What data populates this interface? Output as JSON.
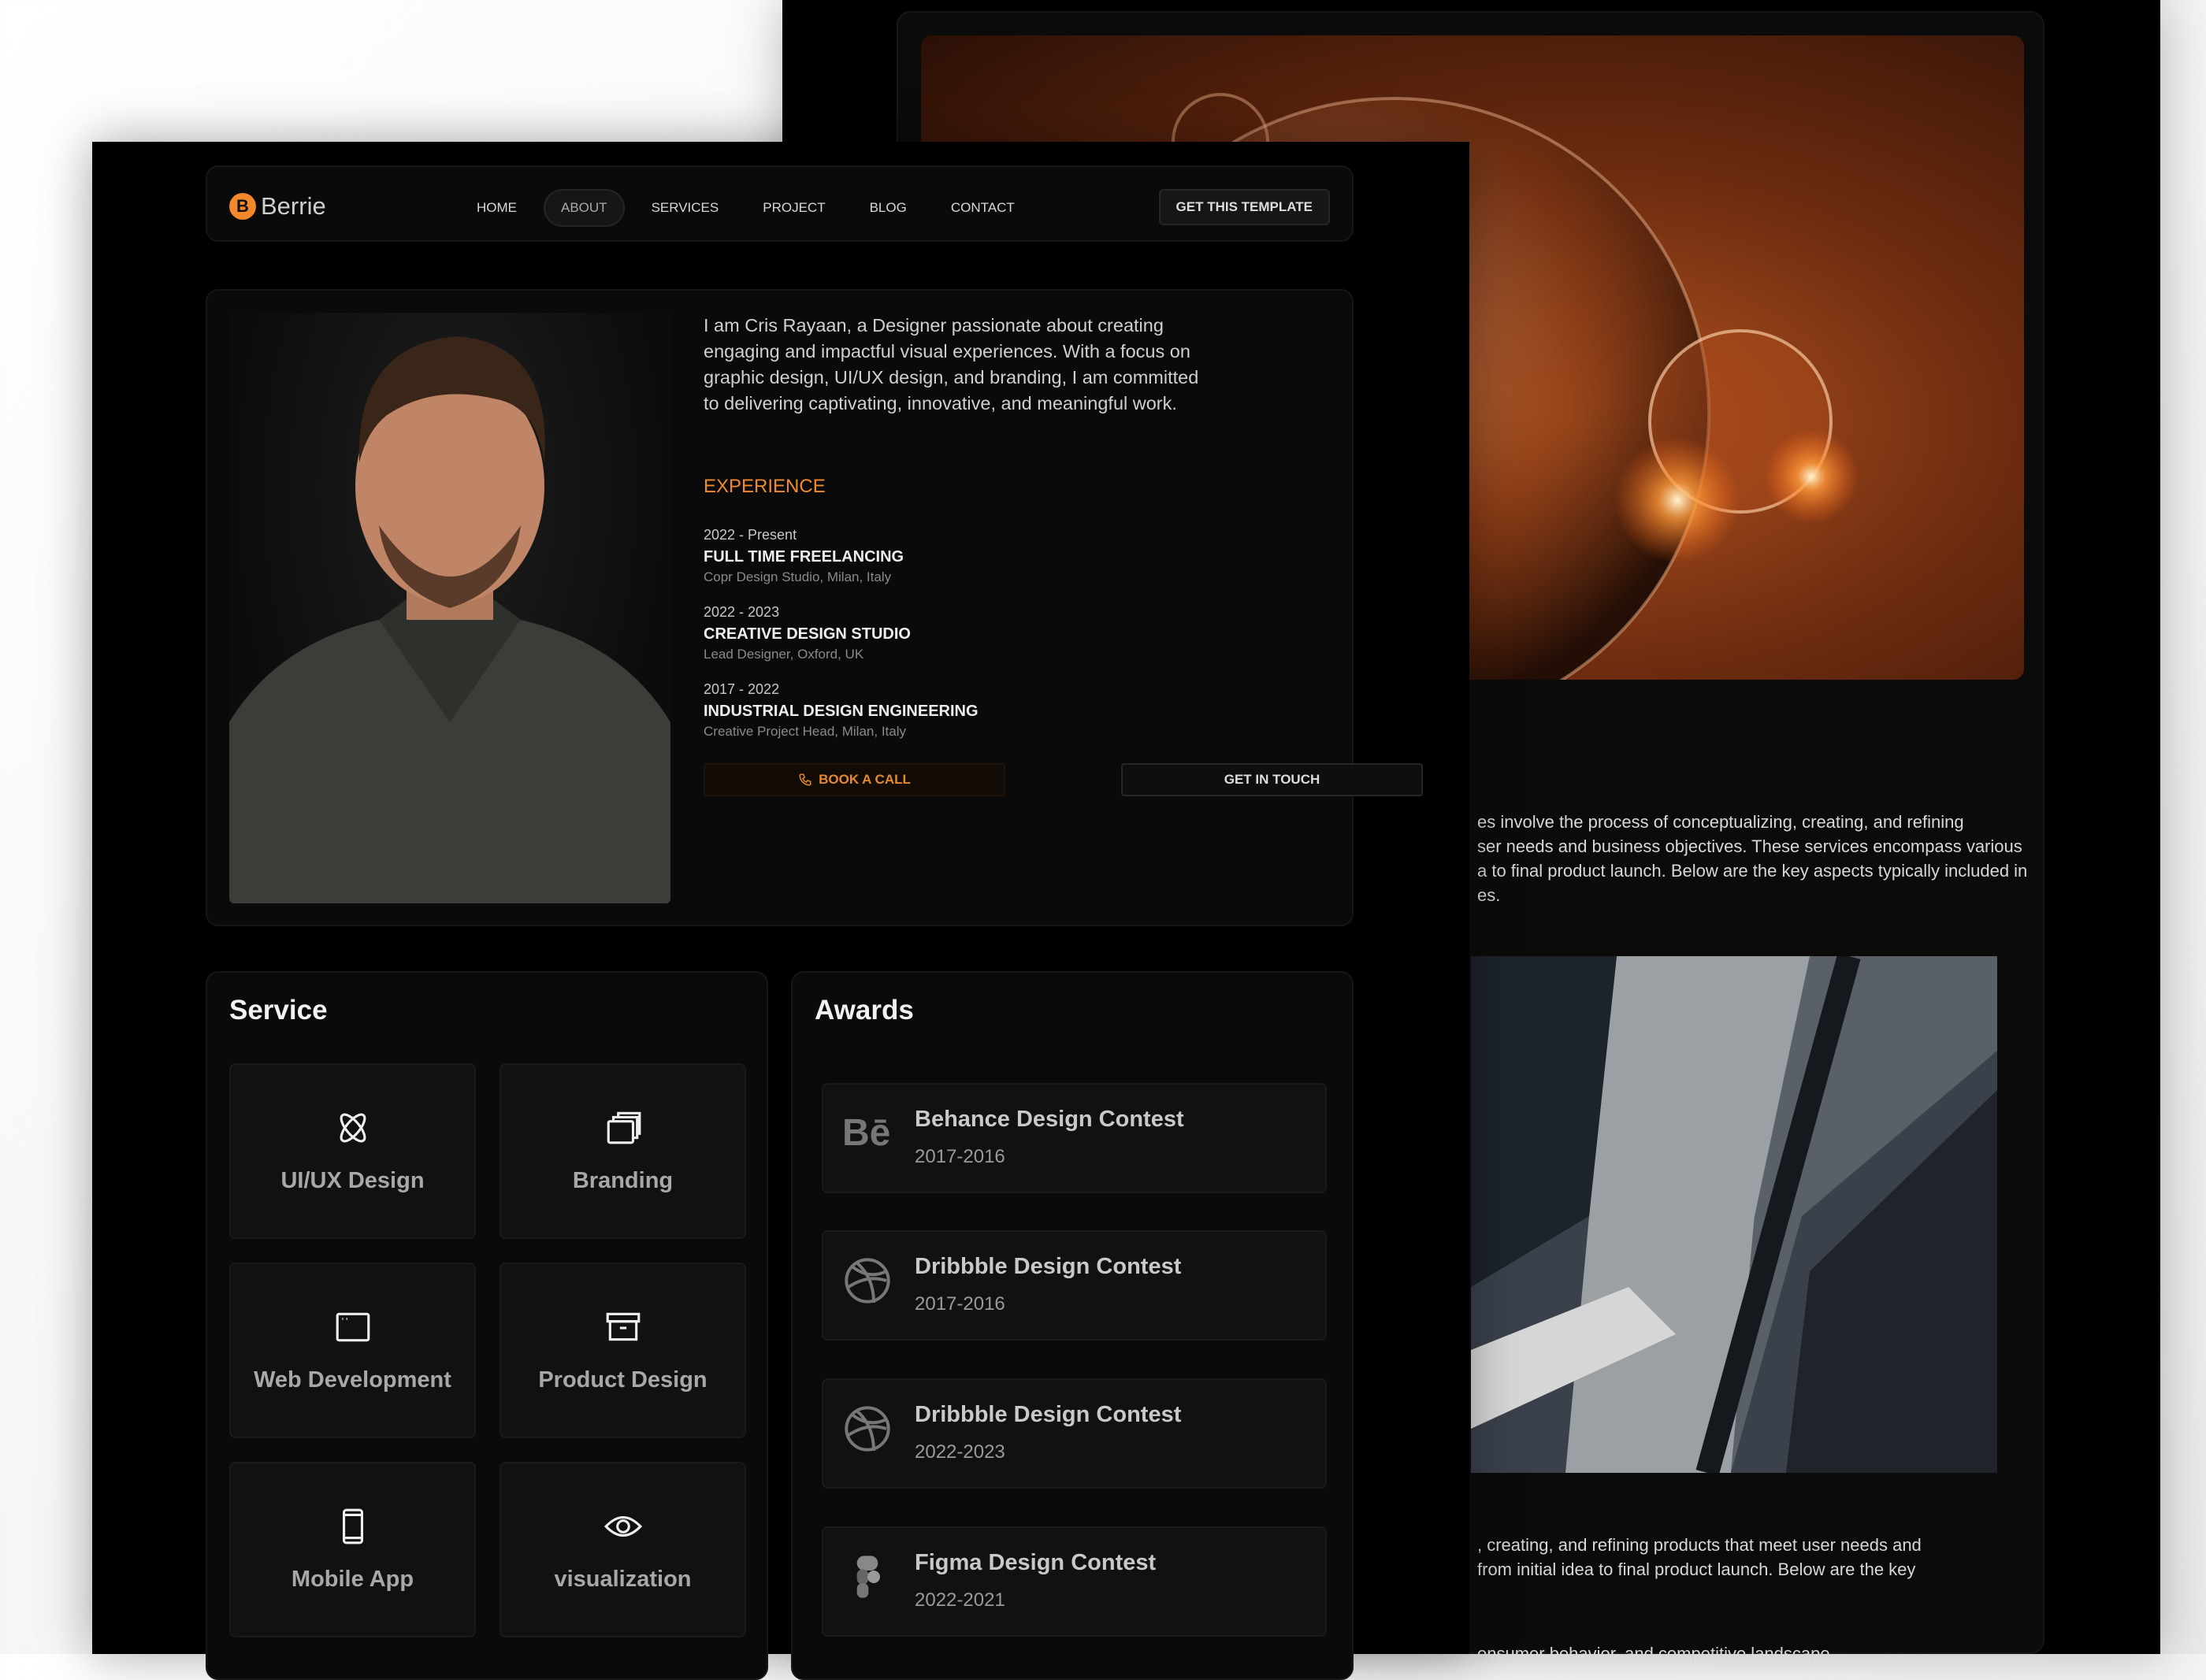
{
  "nav": {
    "logo": "Berrie",
    "logo_mark": "B",
    "links": [
      "HOME",
      "ABOUT",
      "SERVICES",
      "PROJECT",
      "BLOG",
      "CONTACT"
    ],
    "active": "ABOUT",
    "cta": "GET THIS TEMPLATE"
  },
  "hero": {
    "bio": "I am Cris Rayaan, a Designer passionate about creating engaging and impactful visual experiences. With a focus on graphic design, UI/UX design, and branding, I am committed to delivering captivating, innovative, and meaningful work.",
    "experience_title": "EXPERIENCE",
    "experience": [
      {
        "years": "2022 - Present",
        "role": "FULL TIME FREELANCING",
        "org": "Copr Design Studio, Milan, Italy"
      },
      {
        "years": "2022 - 2023",
        "role": "CREATIVE DESIGN STUDIO",
        "org": "Lead Designer, Oxford, UK"
      },
      {
        "years": "2017 - 2022",
        "role": "INDUSTRIAL DESIGN ENGINEERING",
        "org": "Creative Project Head, Milan, Italy"
      }
    ],
    "book_call": "BOOK A CALL",
    "get_in_touch": "GET IN TOUCH"
  },
  "service": {
    "title": "Service",
    "items": [
      {
        "label": "UI/UX Design",
        "icon": "atom-icon"
      },
      {
        "label": "Branding",
        "icon": "stack-icon"
      },
      {
        "label": "Web Development",
        "icon": "browser-window-icon"
      },
      {
        "label": "Product Design",
        "icon": "archive-box-icon"
      },
      {
        "label": "Mobile App",
        "icon": "smartphone-icon"
      },
      {
        "label": "visualization",
        "icon": "eye-icon"
      }
    ]
  },
  "awards": {
    "title": "Awards",
    "items": [
      {
        "title": "Behance Design Contest",
        "years": "2017-2016",
        "icon": "behance-icon"
      },
      {
        "title": "Dribbble Design Contest",
        "years": "2017-2016",
        "icon": "dribbble-icon"
      },
      {
        "title": "Dribbble Design Contest",
        "years": "2022-2023",
        "icon": "dribbble-icon"
      },
      {
        "title": "Figma Design Contest",
        "years": "2022-2021",
        "icon": "figma-icon"
      }
    ]
  },
  "back_page": {
    "text1": [
      "es involve the process of conceptualizing, creating, and refining",
      "ser needs and business objectives. These services encompass various",
      "a to final product launch. Below are the key aspects typically included in",
      "es."
    ],
    "text2": [
      ", creating, and refining products that meet user needs and",
      "from initial idea to final product launch. Below are the key"
    ],
    "text3": "onsumer behavior, and competitive landscape."
  },
  "colors": {
    "accent": "#f08a2e",
    "bg": "#000000",
    "card": "#0a0a0a",
    "tile": "#111111"
  }
}
